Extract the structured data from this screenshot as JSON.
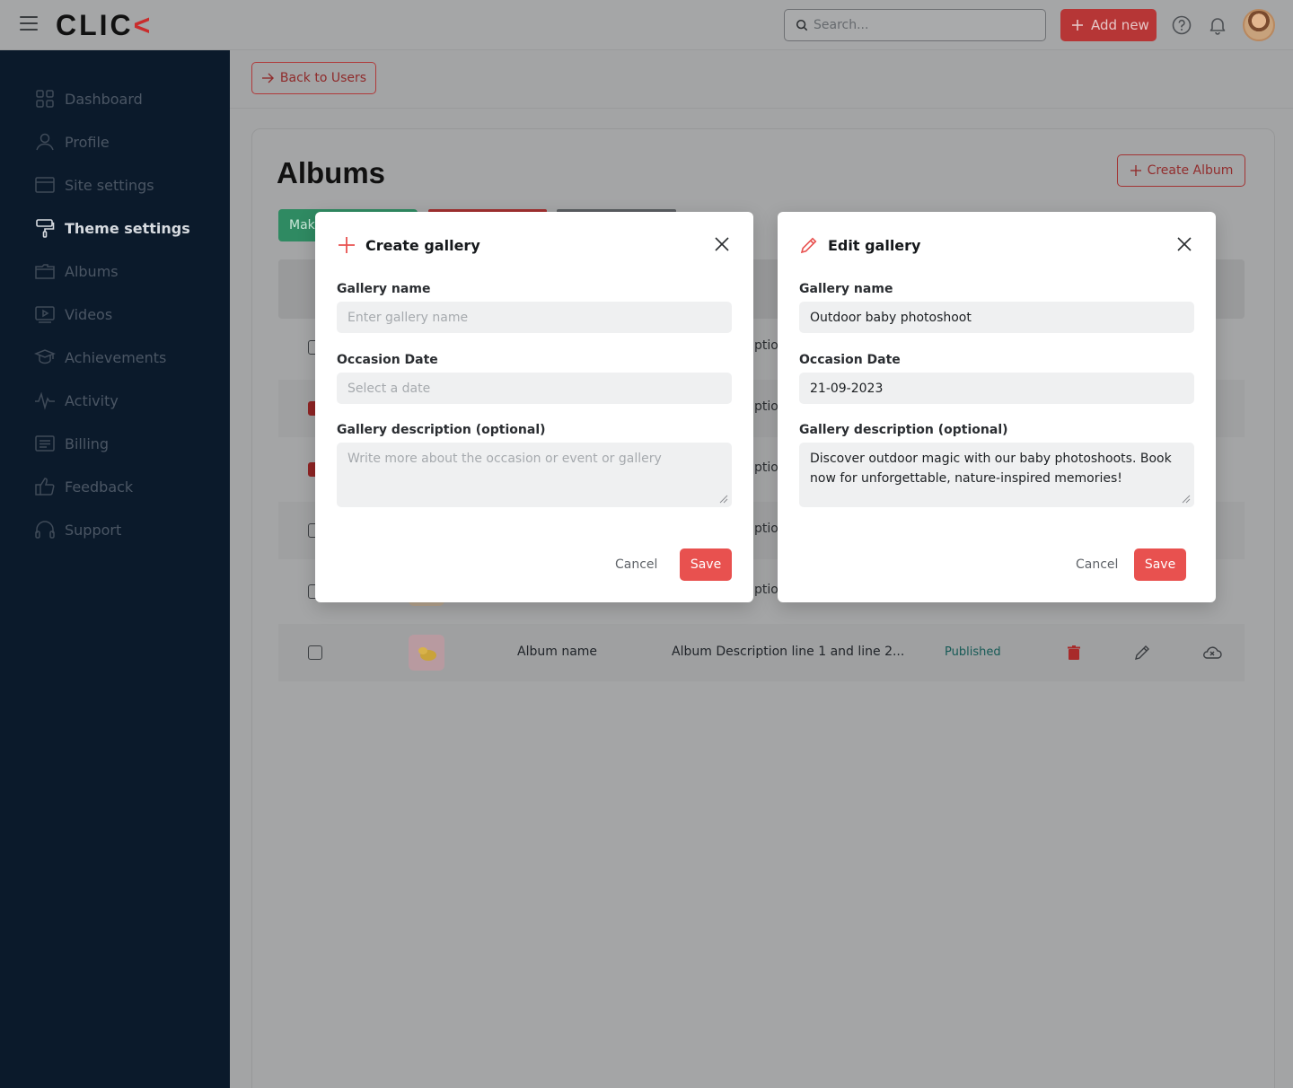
{
  "header": {
    "logo_text": "CLIC",
    "logo_accent": "<",
    "search_placeholder": "Search...",
    "add_new_label": "Add new"
  },
  "sidebar": {
    "items": [
      {
        "label": "Dashboard",
        "icon": "grid-icon"
      },
      {
        "label": "Profile",
        "icon": "user-icon"
      },
      {
        "label": "Site settings",
        "icon": "browser-icon"
      },
      {
        "label": "Theme settings",
        "icon": "paint-roller-icon",
        "active": true
      },
      {
        "label": "Albums",
        "icon": "folder-icon"
      },
      {
        "label": "Videos",
        "icon": "video-icon"
      },
      {
        "label": "Achievements",
        "icon": "medal-icon"
      },
      {
        "label": "Activity",
        "icon": "activity-icon"
      },
      {
        "label": "Billing",
        "icon": "receipt-icon"
      },
      {
        "label": "Feedback",
        "icon": "thumbs-up-icon"
      },
      {
        "label": "Support",
        "icon": "headset-icon"
      }
    ]
  },
  "main": {
    "back_label": "Back to Users",
    "title": "Albums",
    "create_album_label": "Create Album",
    "tab_peek": "Mak",
    "table_peek_header": "l",
    "peek_text": "ptio",
    "last_row": {
      "name": "Album name",
      "description": "Album Description line 1 and line 2...",
      "status": "Published"
    }
  },
  "create_modal": {
    "title": "Create gallery",
    "name_label": "Gallery name",
    "name_placeholder": "Enter gallery name",
    "date_label": "Occasion Date",
    "date_placeholder": "Select a date",
    "desc_label": "Gallery description (optional)",
    "desc_placeholder": "Write more about the occasion or event or gallery",
    "cancel_label": "Cancel",
    "save_label": "Save"
  },
  "edit_modal": {
    "title": "Edit gallery",
    "name_label": "Gallery name",
    "name_value": "Outdoor baby photoshoot",
    "date_label": "Occasion Date",
    "date_value": "21-09-2023",
    "desc_label": "Gallery description (optional)",
    "desc_value": "Discover outdoor magic with our baby photoshoots. Book now for unforgettable, nature-inspired memories!",
    "cancel_label": "Cancel",
    "save_label": "Save"
  },
  "colors": {
    "accent": "#e8514f",
    "sidebar_bg": "#0b1a2b",
    "status_published": "#165a56",
    "green_button": "#2f8a62"
  }
}
